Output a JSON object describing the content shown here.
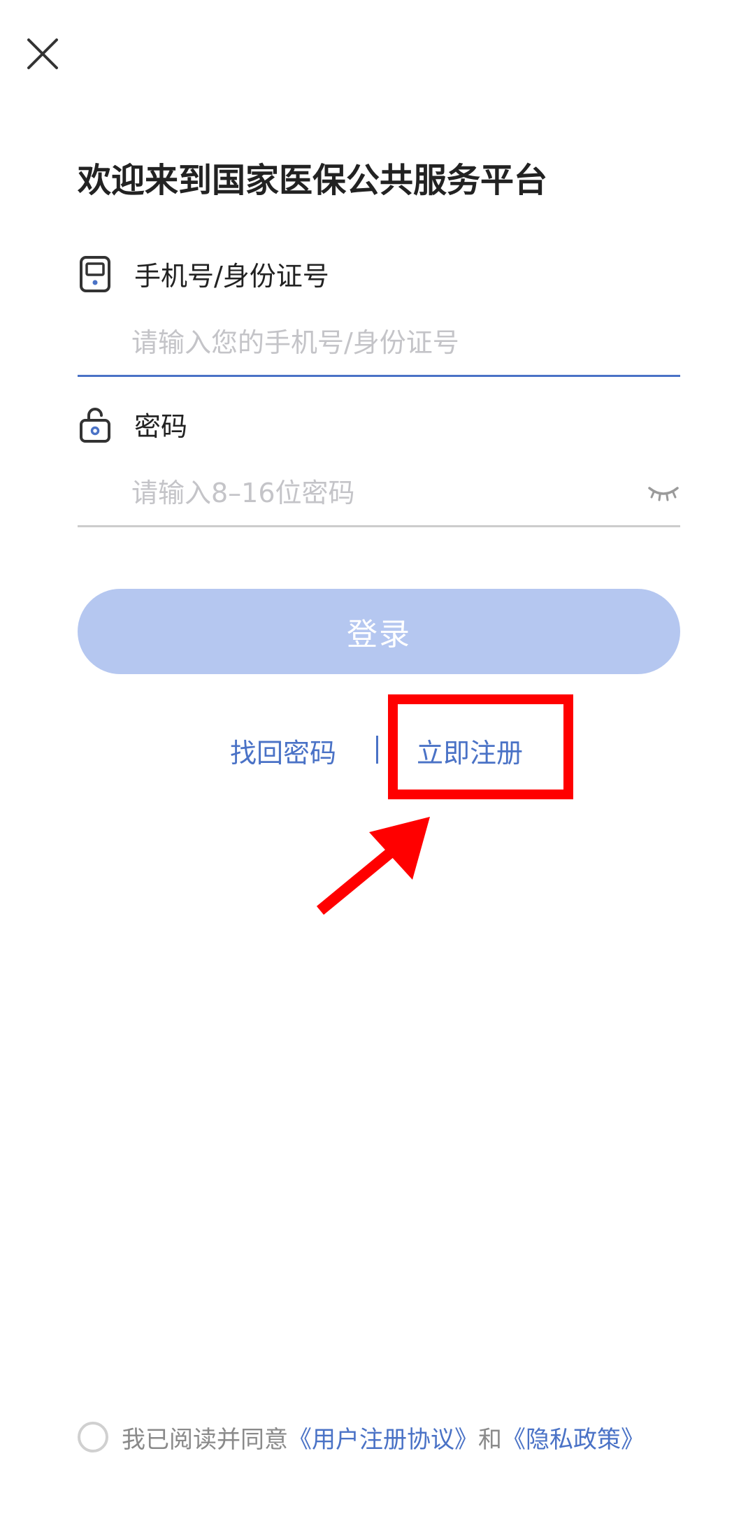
{
  "header": {
    "close_icon": "close-icon"
  },
  "title": "欢迎来到国家医保公共服务平台",
  "account_field": {
    "icon": "phone-icon",
    "label": "手机号/身份证号",
    "placeholder": "请输入您的手机号/身份证号",
    "value": "",
    "underline_color": "#4a72c6"
  },
  "password_field": {
    "icon": "lock-icon",
    "label": "密码",
    "placeholder": "请输入8–16位密码",
    "value": "",
    "toggle_icon": "eye-closed-icon",
    "underline_color": "#cccccc"
  },
  "login_button": {
    "label": "登录",
    "color": "#b5c7f0"
  },
  "links": {
    "forgot_password": "找回密码",
    "divider": "|",
    "register": "立即注册",
    "link_color": "#4a72c6"
  },
  "annotation": {
    "highlight_color": "#ff0000",
    "arrow_icon": "arrow-icon"
  },
  "agreement": {
    "checked": false,
    "prefix": "我已阅读并同意",
    "user_agreement": "《用户注册协议》",
    "conjunction": "和",
    "privacy_policy": "《隐私政策》"
  }
}
